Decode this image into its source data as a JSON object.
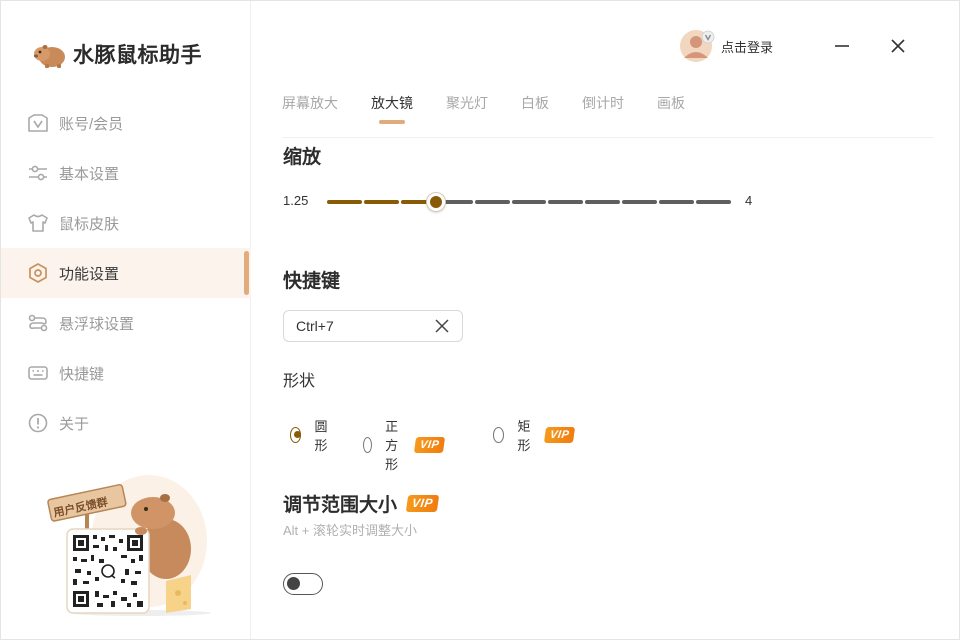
{
  "app": {
    "name": "水豚鼠标助手"
  },
  "header": {
    "login_label": "点击登录",
    "minimize": "minimize",
    "close": "close"
  },
  "sidebar": {
    "items": [
      {
        "label": "账号/会员",
        "icon": "vip-card-icon",
        "active": false
      },
      {
        "label": "基本设置",
        "icon": "sliders-icon",
        "active": false
      },
      {
        "label": "鼠标皮肤",
        "icon": "tshirt-icon",
        "active": false
      },
      {
        "label": "功能设置",
        "icon": "hexagon-settings-icon",
        "active": true
      },
      {
        "label": "悬浮球设置",
        "icon": "route-icon",
        "active": false
      },
      {
        "label": "快捷键",
        "icon": "keyboard-icon",
        "active": false
      },
      {
        "label": "关于",
        "icon": "info-icon",
        "active": false
      }
    ],
    "feedback_sign": "用户反馈群"
  },
  "tabs": [
    {
      "label": "屏幕放大",
      "active": false
    },
    {
      "label": "放大镜",
      "active": true
    },
    {
      "label": "聚光灯",
      "active": false
    },
    {
      "label": "白板",
      "active": false
    },
    {
      "label": "倒计时",
      "active": false
    },
    {
      "label": "画板",
      "active": false
    }
  ],
  "zoom": {
    "title": "缩放",
    "min_label": "1.25",
    "max_label": "4",
    "value_fraction": 0.27
  },
  "hotkey": {
    "title": "快捷键",
    "value": "Ctrl+7"
  },
  "shape": {
    "title": "形状",
    "options": [
      {
        "label": "圆形",
        "checked": true,
        "vip": false
      },
      {
        "label": "正方形",
        "checked": false,
        "vip": true
      },
      {
        "label": "矩形",
        "checked": false,
        "vip": true
      }
    ],
    "vip_badge": "VIP"
  },
  "range": {
    "title": "调节范围大小",
    "vip_badge": "VIP",
    "hint": "Alt + 滚轮实时调整大小",
    "toggle_on": false
  },
  "colors": {
    "accent": "#e0ac7c",
    "slider_active": "#8a5b07",
    "slider_inactive": "#5f5f5f",
    "vip": "#f28a14"
  }
}
